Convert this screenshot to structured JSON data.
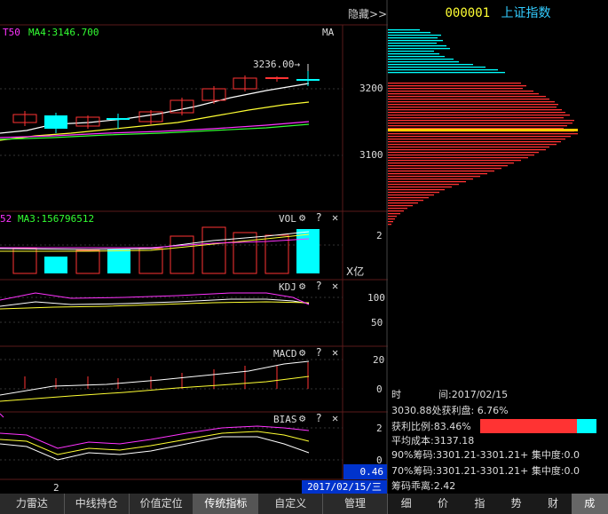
{
  "header": {
    "hide_label": "隐藏>>",
    "stock_code": "000001",
    "stock_name": "上证指数"
  },
  "price_pane": {
    "ma_left_label": "T50",
    "ma4_label": "MA4:3146.700",
    "indicator_name": "MA",
    "annotation": "3236.00",
    "annotation_arrow": "→",
    "axis_ticks": [
      "3200",
      "3100"
    ]
  },
  "vol_pane": {
    "left_value": "52",
    "ma3_label": "MA3:156796512",
    "indicator_name": "VOL",
    "unit_label": "X亿",
    "axis_ticks": [
      "2"
    ]
  },
  "kdj_pane": {
    "indicator_name": "KDJ",
    "axis_ticks": [
      "100",
      "50"
    ]
  },
  "macd_pane": {
    "indicator_name": "MACD",
    "axis_ticks": [
      "20",
      "0"
    ]
  },
  "bias_pane": {
    "indicator_name": "BIAS",
    "axis_ticks": [
      "2",
      "0"
    ],
    "current_value": "0.46"
  },
  "x_axis": {
    "label": "2",
    "date_label": "2017/02/15/三"
  },
  "pane_controls": {
    "gear": "⚙",
    "help": "?",
    "close": "✕"
  },
  "chip_axis": {
    "ticks": [
      "3200",
      "3100",
      "2"
    ]
  },
  "chip_info": {
    "time_label": "时",
    "time_value": "间:2017/02/15",
    "profit_line": "3030.88处获利盘: 6.76%",
    "profit_ratio": "获利比例:83.46%",
    "profit_ratio_value": 0.8346,
    "avg_cost": "平均成本:3137.18",
    "chip90": "90%筹码:3301.21-3301.21+ 集中度:0.0",
    "chip70": "70%筹码:3301.21-3301.21+ 集中度:0.0",
    "distance": "筹码乖离:2.42"
  },
  "bottom_tabs": [
    "力雷达",
    "中线持仓",
    "价值定位",
    "传统指标",
    "自定义",
    "管理"
  ],
  "active_bottom_tab": "传统指标",
  "right_tabs": [
    "细",
    "价",
    "指",
    "势",
    "财",
    "成"
  ],
  "active_right_tab": "成",
  "colors": {
    "up": "#ff3333",
    "down": "#00ffff",
    "ma_white": "#ffffff",
    "ma_yellow": "#ffff33",
    "ma_magenta": "#ff33ff",
    "ma_green": "#33ff33",
    "avg_cost_line": "#ffcc00",
    "code_color": "#ffff33",
    "name_color": "#33ccff"
  }
}
